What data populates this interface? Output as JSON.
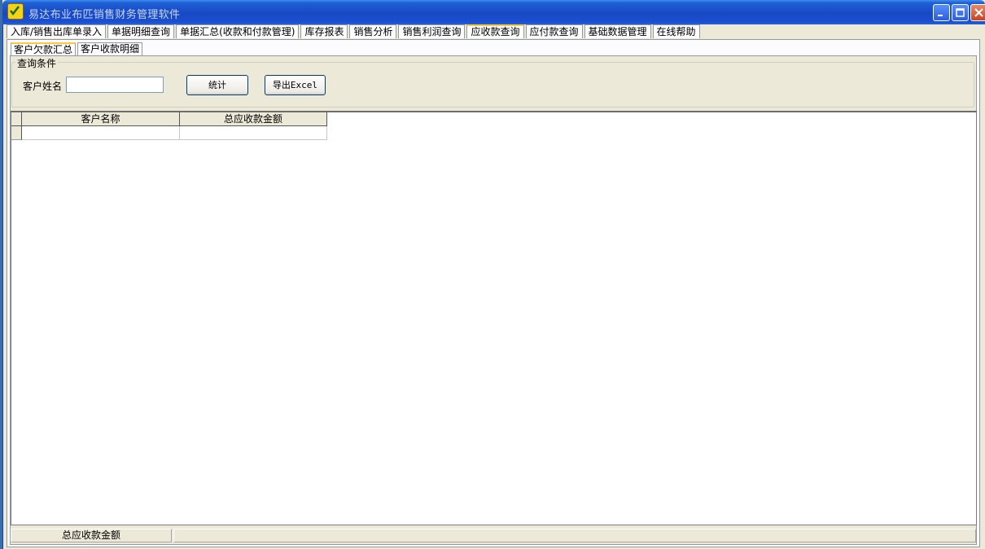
{
  "window": {
    "title": "易达布业布匹销售财务管理软件"
  },
  "main_tabs": [
    {
      "label": "入库/销售出库单录入"
    },
    {
      "label": "单据明细查询"
    },
    {
      "label": "单据汇总(收款和付款管理)"
    },
    {
      "label": "库存报表"
    },
    {
      "label": "销售分析"
    },
    {
      "label": "销售利润查询"
    },
    {
      "label": "应收款查询"
    },
    {
      "label": "应付款查询"
    },
    {
      "label": "基础数据管理"
    },
    {
      "label": "在线帮助"
    }
  ],
  "active_main_tab": "应收款查询",
  "sub_tabs": [
    {
      "label": "客户欠款汇总"
    },
    {
      "label": "客户收款明细"
    }
  ],
  "query": {
    "group_title": "查询条件",
    "customer_name_label": "客户姓名",
    "customer_name_value": "",
    "stat_button": "统计",
    "export_button": "导出Excel"
  },
  "grid": {
    "columns": [
      "客户名称",
      "总应收款金额"
    ],
    "rows": [
      [
        "",
        ""
      ]
    ]
  },
  "footer": {
    "total_label": "总应收款金额",
    "total_value": ""
  },
  "colors": {
    "titlebar": "#1848c4",
    "active_tab_accent": "#ffc83c",
    "face": "#ece9d8"
  }
}
